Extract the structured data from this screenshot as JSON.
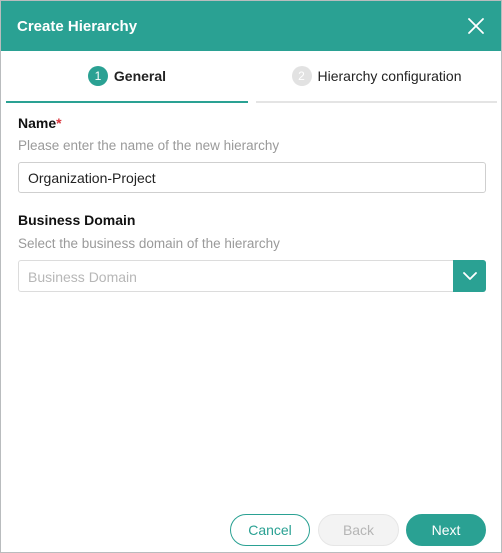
{
  "dialog": {
    "title": "Create Hierarchy",
    "close_icon": "close-icon"
  },
  "steps": [
    {
      "number": "1",
      "label": "General",
      "active": true
    },
    {
      "number": "2",
      "label": "Hierarchy configuration",
      "active": false
    }
  ],
  "form": {
    "name": {
      "label": "Name",
      "required_marker": "*",
      "help": "Please enter the name of the new hierarchy",
      "value": "Organization-Project"
    },
    "business_domain": {
      "label": "Business Domain",
      "help": "Select the business domain of the hierarchy",
      "placeholder": "Business Domain",
      "toggle_icon": "chevron-down-icon"
    }
  },
  "actions": {
    "cancel_label": "Cancel",
    "back_label": "Back",
    "next_label": "Next"
  },
  "colors": {
    "accent": "#2aa193",
    "required": "#d9363e",
    "help_text": "#9a9a9a"
  }
}
